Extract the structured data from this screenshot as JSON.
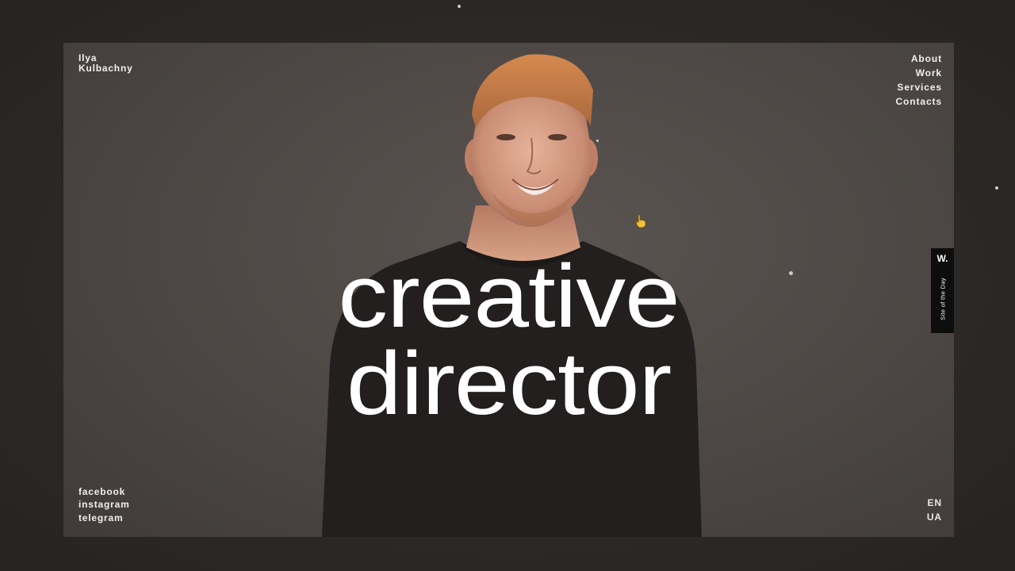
{
  "header": {
    "name_line1": "Ilya",
    "name_line2": "Kulbachny"
  },
  "nav": {
    "items": [
      "About",
      "Work",
      "Services",
      "Contacts"
    ]
  },
  "hero": {
    "line1": "creative",
    "line2": "director"
  },
  "social": {
    "items": [
      "facebook",
      "instagram",
      "telegram"
    ]
  },
  "language": {
    "items": [
      "EN",
      "UA"
    ]
  },
  "badge": {
    "logo": "W.",
    "label": "Site of the Day"
  },
  "icons": {
    "cursor": "hand-pointer-icon"
  },
  "colors": {
    "background": "#2d2826",
    "stage": "#4c4744",
    "text": "#ffffff",
    "badge": "#0d0d0d"
  }
}
